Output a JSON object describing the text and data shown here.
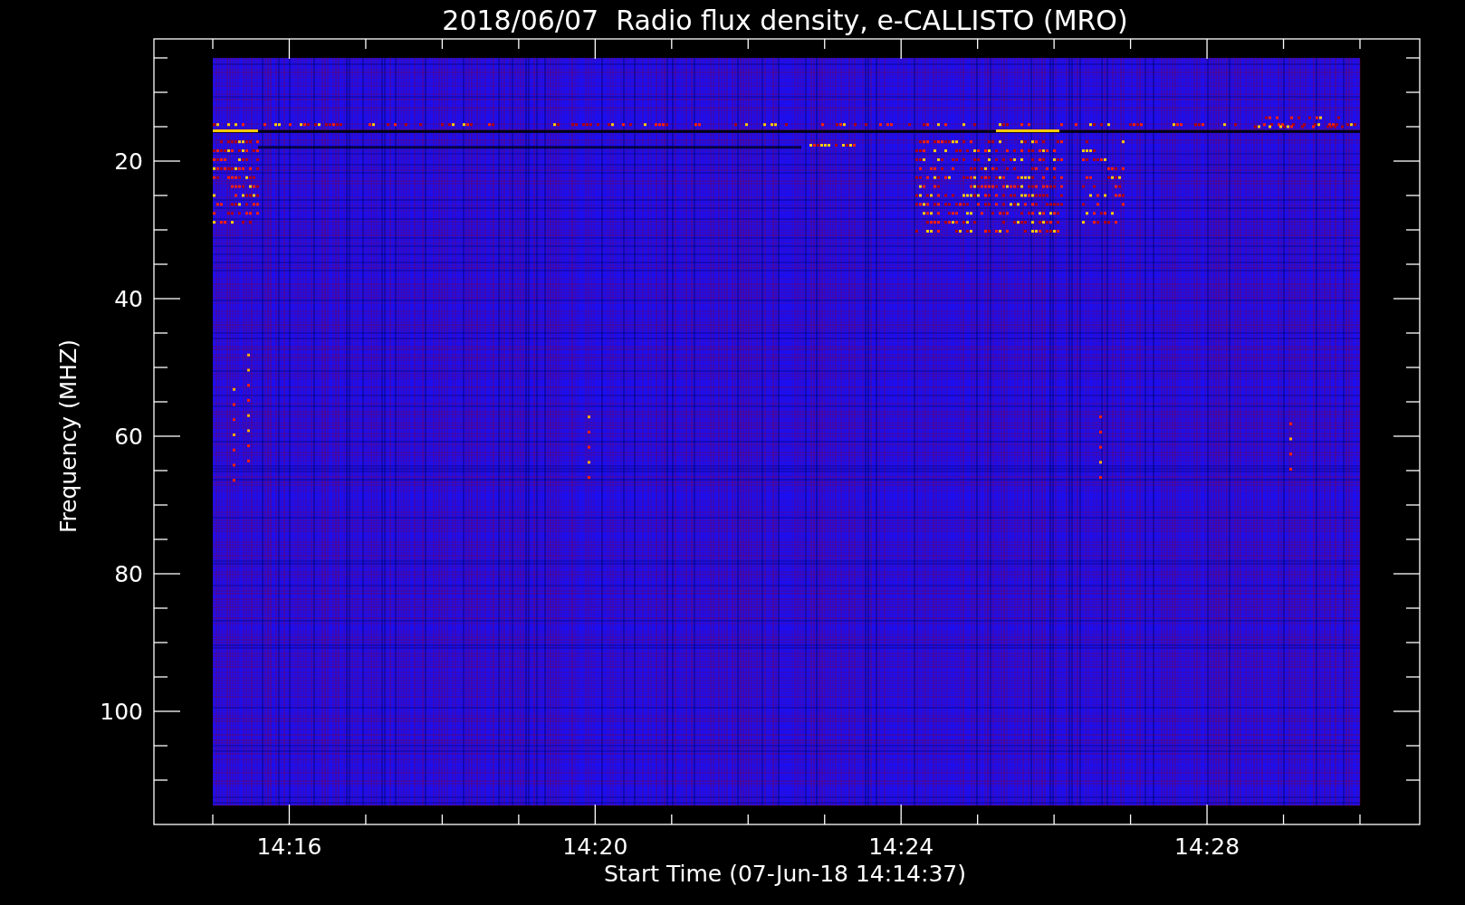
{
  "chart": {
    "title": "2018/06/07  Radio flux density, e-CALLISTO (MRO)",
    "ylabel": "Frequency (MHZ)",
    "xlabel": "Start Time (07-Jun-18 14:14:37)",
    "yticks": [
      "20",
      "40",
      "60",
      "80",
      "100"
    ],
    "xticks": [
      "14:16",
      "14:20",
      "14:24",
      "14:28"
    ]
  }
}
